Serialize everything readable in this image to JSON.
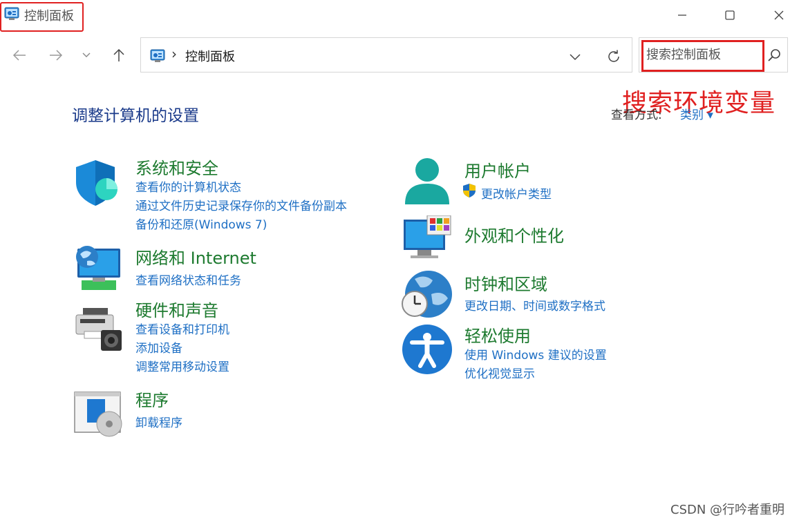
{
  "window": {
    "title": "控制面板"
  },
  "address": {
    "path": "控制面板",
    "separator": "›"
  },
  "search": {
    "placeholder": "搜索控制面板"
  },
  "annotation": "搜索环境变量",
  "main": {
    "heading": "调整计算机的设置",
    "view_by_label": "查看方式:",
    "view_by_value": "类别 ▾"
  },
  "categories": {
    "system": {
      "title": "系统和安全",
      "links": [
        "查看你的计算机状态",
        "通过文件历史记录保存你的文件备份副本",
        "备份和还原(Windows 7)"
      ]
    },
    "network": {
      "title": "网络和 Internet",
      "links": [
        "查看网络状态和任务"
      ]
    },
    "hardware": {
      "title": "硬件和声音",
      "links": [
        "查看设备和打印机",
        "添加设备",
        "调整常用移动设置"
      ]
    },
    "programs": {
      "title": "程序",
      "links": [
        "卸载程序"
      ]
    },
    "user": {
      "title": "用户帐户",
      "links": [
        "更改帐户类型"
      ]
    },
    "appearance": {
      "title": "外观和个性化",
      "links": []
    },
    "clock": {
      "title": "时钟和区域",
      "links": [
        "更改日期、时间或数字格式"
      ]
    },
    "ease": {
      "title": "轻松使用",
      "links": [
        "使用 Windows 建议的设置",
        "优化视觉显示"
      ]
    }
  },
  "watermark": "CSDN @行吟者重明",
  "colors": {
    "heading": "#1a3a8a",
    "category_title": "#1d7a2f",
    "link": "#1e6fc4",
    "highlight": "#e02020"
  },
  "icons": {
    "window": "control-panel-icon",
    "back": "arrow-left-icon",
    "forward": "arrow-right-icon",
    "recent": "chevron-down-icon",
    "up": "arrow-up-icon",
    "refresh": "refresh-icon",
    "search": "search-icon",
    "minimize": "minimize-icon",
    "maximize": "maximize-icon",
    "close": "close-icon"
  }
}
